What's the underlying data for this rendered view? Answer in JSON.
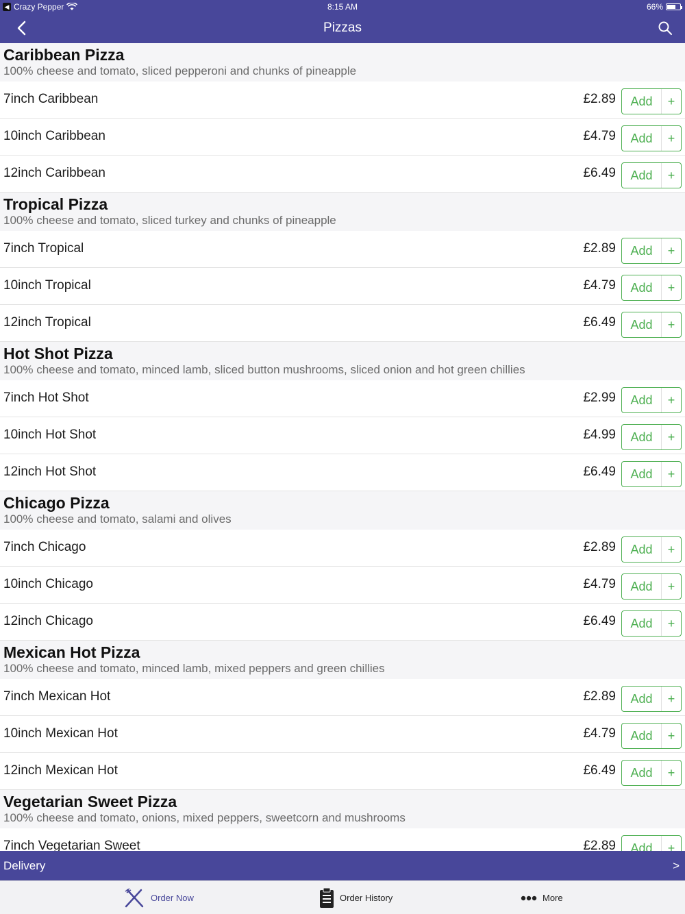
{
  "status": {
    "back_app": "Crazy Pepper",
    "time": "8:15 AM",
    "battery": "66%",
    "battery_level": 0.66
  },
  "nav": {
    "title": "Pizzas"
  },
  "sections": [
    {
      "name": "Caribbean Pizza",
      "description": "100% cheese and tomato, sliced pepperoni and chunks of pineapple",
      "items": [
        {
          "name": "7inch Caribbean",
          "price": "£2.89"
        },
        {
          "name": "10inch Caribbean",
          "price": "£4.79"
        },
        {
          "name": "12inch Caribbean",
          "price": "£6.49"
        }
      ]
    },
    {
      "name": "Tropical Pizza",
      "description": "100% cheese and tomato, sliced turkey and chunks of pineapple",
      "items": [
        {
          "name": "7inch Tropical",
          "price": "£2.89"
        },
        {
          "name": "10inch Tropical",
          "price": "£4.79"
        },
        {
          "name": "12inch Tropical",
          "price": "£6.49"
        }
      ]
    },
    {
      "name": "Hot Shot Pizza",
      "description": "100% cheese and tomato, minced lamb, sliced button mushrooms, sliced onion and hot green chillies",
      "items": [
        {
          "name": "7inch Hot Shot",
          "price": "£2.99"
        },
        {
          "name": "10inch Hot Shot",
          "price": "£4.99"
        },
        {
          "name": "12inch Hot Shot",
          "price": "£6.49"
        }
      ]
    },
    {
      "name": "Chicago Pizza",
      "description": "100% cheese and tomato, salami and olives",
      "items": [
        {
          "name": "7inch Chicago",
          "price": "£2.89"
        },
        {
          "name": "10inch Chicago",
          "price": "£4.79"
        },
        {
          "name": "12inch Chicago",
          "price": "£6.49"
        }
      ]
    },
    {
      "name": "Mexican Hot Pizza",
      "description": "100% cheese and tomato, minced lamb, mixed peppers and green chillies",
      "items": [
        {
          "name": "7inch Mexican Hot",
          "price": "£2.89"
        },
        {
          "name": "10inch Mexican Hot",
          "price": "£4.79"
        },
        {
          "name": "12inch Mexican Hot",
          "price": "£6.49"
        }
      ]
    },
    {
      "name": "Vegetarian Sweet Pizza",
      "description": "100% cheese and tomato, onions, mixed peppers, sweetcorn and mushrooms",
      "items": [
        {
          "name": "7inch Vegetarian Sweet",
          "price": "£2.89"
        }
      ]
    }
  ],
  "buttons": {
    "add_label": "Add",
    "plus_label": "+"
  },
  "delivery": {
    "label": "Delivery",
    "arrow": ">"
  },
  "tabs": [
    {
      "label": "Order Now",
      "icon": "fork-knife-icon"
    },
    {
      "label": "Order History",
      "icon": "clipboard-icon"
    },
    {
      "label": "More",
      "icon": "more-dots-icon"
    }
  ],
  "colors": {
    "brand": "#48479a",
    "accent_green": "#4caf50",
    "section_bg": "#f5f5f7"
  }
}
